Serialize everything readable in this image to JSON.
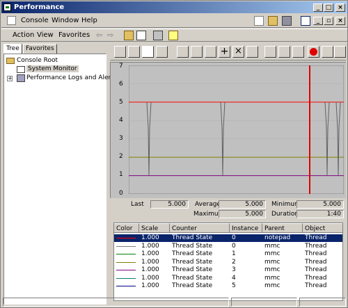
{
  "window": {
    "title": "Performance"
  },
  "menubar": {
    "items": [
      "Console",
      "Window",
      "Help"
    ]
  },
  "actionbar": {
    "items": [
      "Action",
      "View",
      "Favorites"
    ]
  },
  "tree": {
    "tabs": [
      "Tree",
      "Favorites"
    ],
    "nodes": [
      "Console Root",
      "System Monitor",
      "Performance Logs and Alerts"
    ]
  },
  "graph": {
    "y_labels": [
      "7",
      "6",
      "5",
      "4",
      "3",
      "2",
      "1",
      "0"
    ]
  },
  "stats": {
    "last_label": "Last",
    "last_value": "5.000",
    "average_label": "Average",
    "average_value": "5.000",
    "minimum_label": "Minimum",
    "minimum_value": "5.000",
    "maximum_label": "Maximum",
    "maximum_value": "5.000",
    "duration_label": "Duration",
    "duration_value": "1:40"
  },
  "legend": {
    "headers": [
      "Color",
      "Scale",
      "Counter",
      "Instance",
      "Parent",
      "Object"
    ],
    "rows": [
      {
        "color": "#ff0000",
        "scale": "1.000",
        "counter": "Thread State",
        "instance": "0",
        "parent": "notepad",
        "object": "Thread",
        "selected": true
      },
      {
        "color": "#808080",
        "scale": "1.000",
        "counter": "Thread State",
        "instance": "0",
        "parent": "mmc",
        "object": "Thread"
      },
      {
        "color": "#008000",
        "scale": "1.000",
        "counter": "Thread State",
        "instance": "1",
        "parent": "mmc",
        "object": "Thread"
      },
      {
        "color": "#808000",
        "scale": "1.000",
        "counter": "Thread State",
        "instance": "2",
        "parent": "mmc",
        "object": "Thread"
      },
      {
        "color": "#800080",
        "scale": "1.000",
        "counter": "Thread State",
        "instance": "3",
        "parent": "mmc",
        "object": "Thread"
      },
      {
        "color": "#008080",
        "scale": "1.000",
        "counter": "Thread State",
        "instance": "4",
        "parent": "mmc",
        "object": "Thread"
      },
      {
        "color": "#000080",
        "scale": "1.000",
        "counter": "Thread State",
        "instance": "5",
        "parent": "mmc",
        "object": "Thread"
      }
    ]
  },
  "chart_data": {
    "type": "line",
    "ylim": [
      0,
      7
    ],
    "series": [
      {
        "color": "#ff0000",
        "values": [
          5,
          5,
          5,
          5,
          5,
          5,
          5,
          5,
          5,
          5
        ]
      },
      {
        "color": "#808000",
        "values": [
          2,
          2,
          2,
          2,
          2,
          2,
          2,
          2,
          2,
          2
        ]
      },
      {
        "color": "#800080",
        "values": [
          1,
          1,
          1,
          1,
          1,
          1,
          1,
          1,
          1,
          1
        ]
      }
    ]
  }
}
